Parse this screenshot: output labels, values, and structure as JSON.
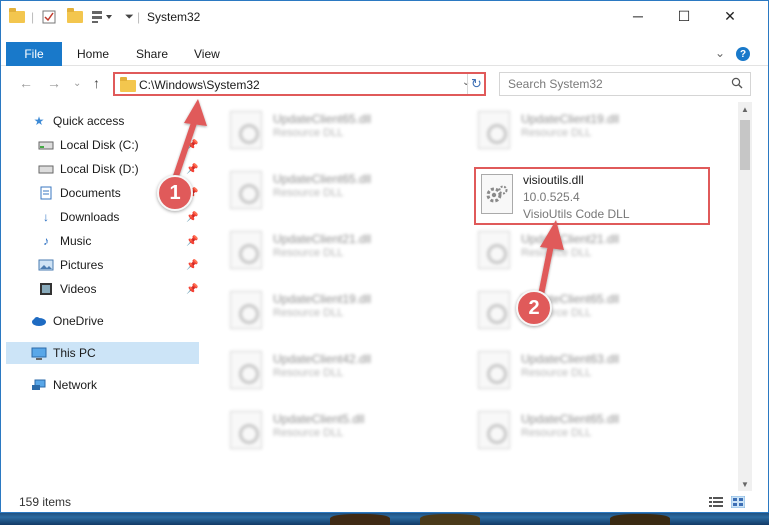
{
  "window": {
    "title": "System32",
    "minimize_glyph": "─",
    "maximize_glyph": "☐",
    "close_glyph": "✕"
  },
  "ribbon": {
    "tabs": [
      "File",
      "Home",
      "Share",
      "View"
    ],
    "expand_glyph": "⌄",
    "help_glyph": "?"
  },
  "navigation": {
    "back_glyph": "←",
    "forward_glyph": "→",
    "recent_glyph": "⌄",
    "up_glyph": "↑"
  },
  "address_bar": {
    "path": "C:\\Windows\\System32",
    "chevron_glyph": "⌄",
    "refresh_glyph": "↻"
  },
  "search": {
    "placeholder": "Search System32"
  },
  "sidebar": {
    "items": [
      {
        "label": "Quick access",
        "icon": "star-icon",
        "pinned": false
      },
      {
        "label": "Local Disk (C:)",
        "icon": "drive-icon",
        "pinned": true
      },
      {
        "label": "Local Disk (D:)",
        "icon": "drive-icon",
        "pinned": true
      },
      {
        "label": "Documents",
        "icon": "documents-icon",
        "pinned": true
      },
      {
        "label": "Downloads",
        "icon": "download-icon",
        "pinned": true
      },
      {
        "label": "Music",
        "icon": "music-icon",
        "pinned": true
      },
      {
        "label": "Pictures",
        "icon": "pictures-icon",
        "pinned": true
      },
      {
        "label": "Videos",
        "icon": "videos-icon",
        "pinned": true
      },
      {
        "label": "OneDrive",
        "icon": "cloud-icon",
        "pinned": false
      },
      {
        "label": "This PC",
        "icon": "pc-icon",
        "pinned": false,
        "selected": true
      },
      {
        "label": "Network",
        "icon": "network-icon",
        "pinned": false
      }
    ]
  },
  "files": [
    {
      "name": "UpdateClient65.dll",
      "desc": "Resource DLL"
    },
    {
      "name": "UpdateClient19.dll",
      "desc": "Resource DLL"
    },
    {
      "name": "UpdateClient65.dll",
      "desc": "Resource DLL"
    },
    {
      "name": "UpdateClient21.dll",
      "desc": "Resource DLL"
    },
    {
      "name": "UpdateClient21.dll",
      "desc": "Resource DLL"
    },
    {
      "name": "UpdateClient19.dll",
      "desc": "Resource DLL"
    },
    {
      "name": "UpdateClient65.dll",
      "desc": "Resource DLL"
    },
    {
      "name": "UpdateClient42.dll",
      "desc": "Resource DLL"
    },
    {
      "name": "UpdateClient63.dll",
      "desc": "Resource DLL"
    },
    {
      "name": "UpdateClient5.dll",
      "desc": "Resource DLL"
    },
    {
      "name": "UpdateClient65.dll",
      "desc": "Resource DLL"
    }
  ],
  "target_file": {
    "name": "visioutils.dll",
    "version": "10.0.525.4",
    "description": "VisioUtils Code DLL",
    "icon": "dll-gear-icon"
  },
  "callouts": {
    "step1": "1",
    "step2": "2"
  },
  "status": {
    "item_count": "159 items"
  },
  "colors": {
    "accent": "#1979ca",
    "highlight": "#e05a5a",
    "selection": "#cce4f7"
  }
}
